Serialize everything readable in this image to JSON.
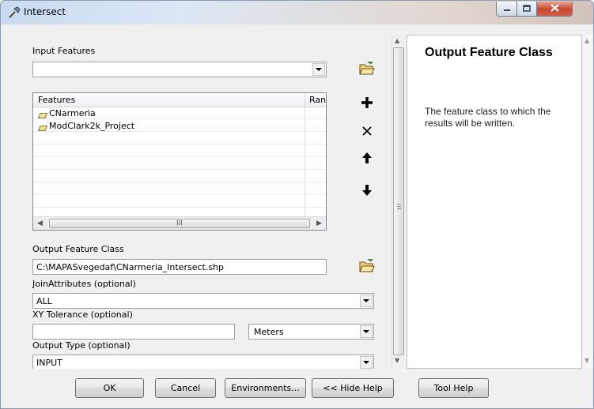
{
  "window": {
    "title": "Intersect",
    "minimize_icon": "minimize-icon",
    "maximize_icon": "maximize-icon",
    "close_icon": "close-icon"
  },
  "form": {
    "input_features": {
      "label": "Input Features",
      "value": "",
      "browse_icon": "open-folder-icon"
    },
    "features_table": {
      "columns": [
        "Features",
        "Ranks"
      ],
      "rows": [
        {
          "feature": "CNarmeria",
          "rank": "",
          "icon": "polygon-layer-icon"
        },
        {
          "feature": "ModClark2k_Project",
          "rank": "",
          "icon": "polygon-layer-icon"
        }
      ],
      "scroll_grip": "III"
    },
    "side_buttons": {
      "add": "plus-icon",
      "remove": "x-icon",
      "up": "arrow-up-icon",
      "down": "arrow-down-icon"
    },
    "output_feature_class": {
      "label": "Output Feature Class",
      "value": "C:\\MAPASvegedaf\\CNarmeria_Intersect.shp",
      "browse_icon": "open-folder-icon"
    },
    "join_attributes": {
      "label": "JoinAttributes (optional)",
      "value": "ALL"
    },
    "xy_tolerance": {
      "label": "XY Tolerance (optional)",
      "value": "",
      "unit": "Meters"
    },
    "output_type": {
      "label": "Output Type (optional)",
      "value": "INPUT"
    }
  },
  "help": {
    "title": "Output Feature Class",
    "body": "The feature class to which the results will be written."
  },
  "buttons": {
    "ok": "OK",
    "cancel": "Cancel",
    "environments": "Environments...",
    "hide_help": "<< Hide Help",
    "tool_help": "Tool Help"
  },
  "colors": {
    "polygon_icon": "#f3e27a",
    "close_button": "#c7452b"
  }
}
